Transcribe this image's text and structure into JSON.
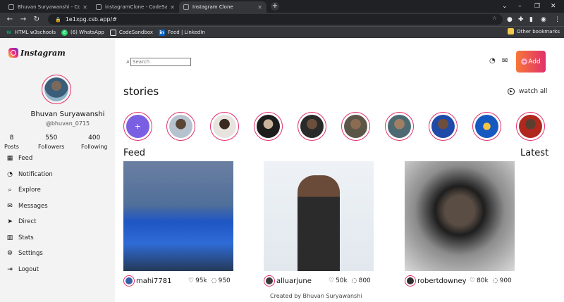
{
  "browser": {
    "tabs": [
      {
        "label": "Bhuvan Suryawanshi - CodeSand",
        "active": false
      },
      {
        "label": "instagramClone - CodeSandbox",
        "active": false
      },
      {
        "label": "Instagram Clone",
        "active": true
      }
    ],
    "url": "1e1xpg.csb.app/#",
    "bookmarks": [
      "HTML w3schools",
      "(6) WhatsApp",
      "CodeSandbox",
      "Feed | LinkedIn"
    ],
    "other_bookmarks": "Other bookmarks"
  },
  "sidebar": {
    "logo_text": "Instagram",
    "profile": {
      "name": "Bhuvan Suryawanshi",
      "username": "@bhuvan_0715"
    },
    "stats": [
      {
        "value": "8",
        "label": "Posts"
      },
      {
        "value": "550",
        "label": "Followers"
      },
      {
        "value": "400",
        "label": "Following"
      }
    ],
    "menu": [
      {
        "label": "Feed",
        "icon": "grid-icon"
      },
      {
        "label": "Notification",
        "icon": "bell-icon"
      },
      {
        "label": "Explore",
        "icon": "search-icon"
      },
      {
        "label": "Messages",
        "icon": "mail-icon"
      },
      {
        "label": "Direct",
        "icon": "send-icon"
      },
      {
        "label": "Stats",
        "icon": "bar-chart-icon"
      },
      {
        "label": "Settings",
        "icon": "gear-icon"
      },
      {
        "label": "Logout",
        "icon": "logout-icon"
      }
    ]
  },
  "header": {
    "search_placeholder": "Search",
    "add_label": "Add"
  },
  "stories": {
    "title": "stories",
    "watch_all": "watch all",
    "add_symbol": "+"
  },
  "feed": {
    "title": "Feed",
    "latest": "Latest",
    "posts": [
      {
        "username": "mahi7781",
        "likes": "95k",
        "comments": "950"
      },
      {
        "username": "alluarjune",
        "likes": "50k",
        "comments": "800"
      },
      {
        "username": "robertdowney",
        "likes": "80k",
        "comments": "900"
      }
    ]
  },
  "footer": {
    "text": "Created by Bhuvan Suryawanshi"
  },
  "colors": {
    "accent": "#e1306c",
    "add_gradient_start": "#f77737",
    "story_add": "#7b5fe3",
    "sidebar_bg": "#f3f3f3"
  }
}
